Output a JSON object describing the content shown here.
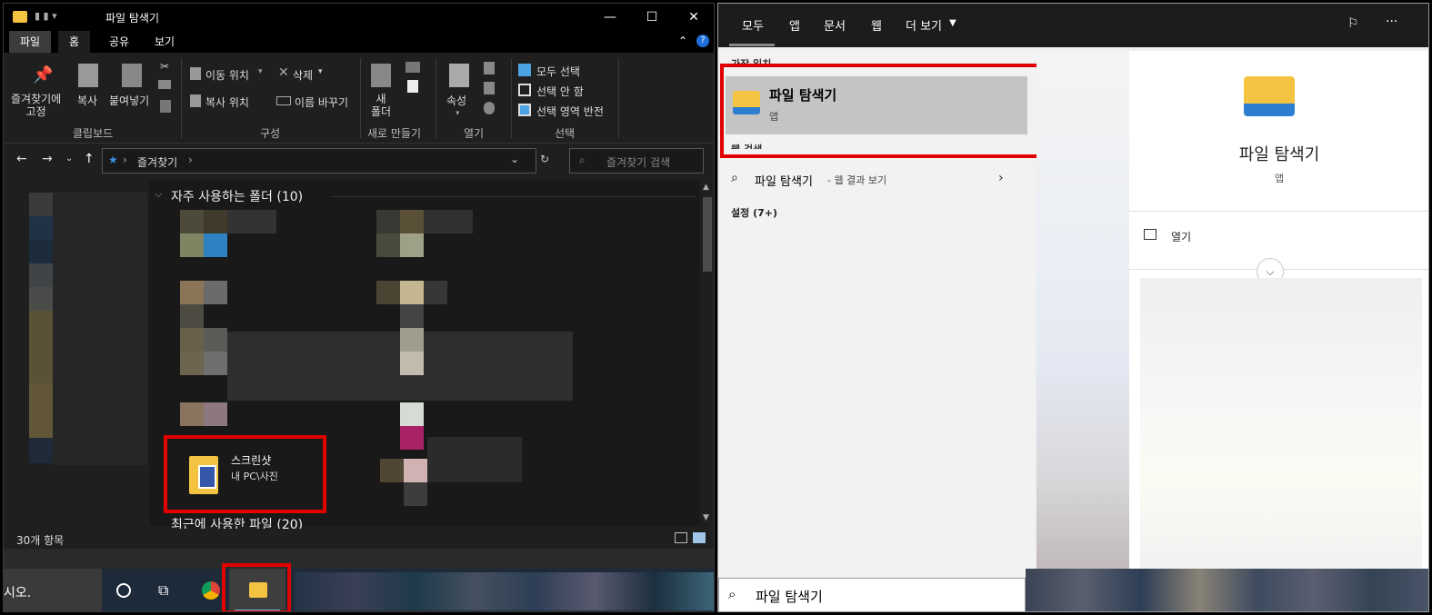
{
  "explorer": {
    "window_title": "파일 탐색기",
    "tabs": [
      "파일",
      "홈",
      "공유",
      "보기"
    ],
    "ribbon": {
      "clipboard": {
        "pin": "즐겨찾기에\n고정",
        "copy": "복사",
        "paste": "붙여넣기",
        "group": "클립보드"
      },
      "organize": {
        "move_to": "이동 위치",
        "copy_to": "복사 위치",
        "delete": "삭제",
        "rename": "이름 바꾸기",
        "group": "구성"
      },
      "new": {
        "new_folder": "새\n폴더",
        "group": "새로 만들기"
      },
      "open": {
        "properties": "속성",
        "group": "열기"
      },
      "select": {
        "select_all": "모두 선택",
        "select_none": "선택 안 함",
        "invert": "선택 영역 반전",
        "group": "선택"
      }
    },
    "address": {
      "location": "즐겨찾기",
      "search_placeholder": "즐겨찾기 검색"
    },
    "sections": {
      "frequent": "자주 사용하는 폴더 (10)",
      "recent": "최근에 사용한 파일 (20)"
    },
    "highlighted_folder": {
      "name": "스크린샷",
      "path": "내 PC\\사진"
    },
    "status": {
      "count": "30개 항목"
    },
    "taskbar": {
      "search_text": "시오."
    }
  },
  "search": {
    "tabs": [
      "모두",
      "앱",
      "문서",
      "웹",
      "더 보기"
    ],
    "best_match_header": "가장 일치",
    "best_match": {
      "title": "파일 탐색기",
      "subtitle": "앱"
    },
    "web_header": "웹 검색",
    "web_result": {
      "query": "파일 탐색기",
      "suffix": " - 웹 결과 보기"
    },
    "settings": "설정 (7+)",
    "detail": {
      "title": "파일 탐색기",
      "subtitle": "앱",
      "action": "열기"
    },
    "query": "파일 탐색기"
  },
  "colors": {
    "highlight_red": "#e00000",
    "folder_yellow": "#f5c342"
  }
}
